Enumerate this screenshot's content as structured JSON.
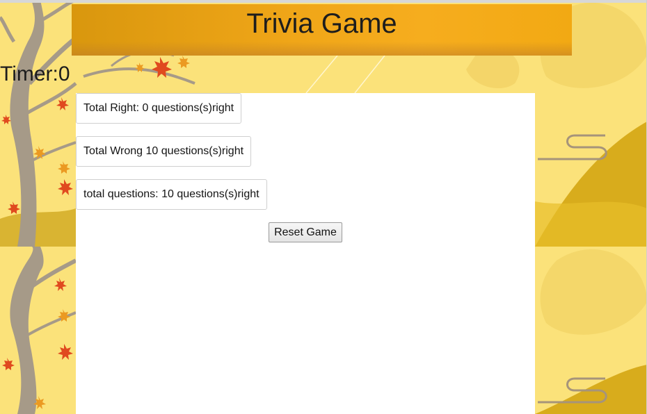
{
  "header": {
    "title": "Trivia Game"
  },
  "timer": {
    "text": "Timer:0"
  },
  "stats": {
    "right": "Total Right: 0 questions(s)right",
    "wrong": "Total Wrong 10 questions(s)right",
    "total": "total questions: 10 questions(s)right"
  },
  "controls": {
    "reset_label": "Reset Game"
  },
  "colors": {
    "background": "#fbe27a",
    "header": "#f0a618",
    "panel": "#ffffff",
    "tree": "#a59a8a",
    "leaf_red": "#e04a1f",
    "leaf_orange": "#eb9a22"
  }
}
